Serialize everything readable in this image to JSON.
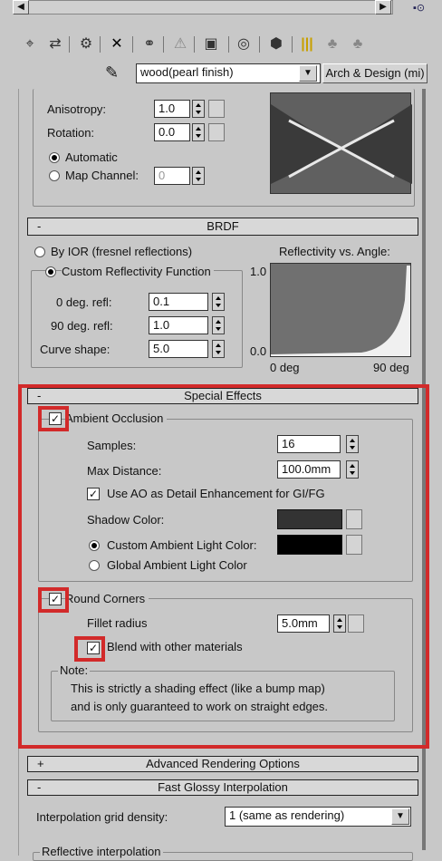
{
  "colors": {
    "panel": "#c8c8c8",
    "highlight": "#d22a2a",
    "shadow_swatch": "#333333",
    "ambient_swatch": "#000000"
  },
  "toolbar": {
    "icons": [
      "pick-material-icon",
      "put-to-scene-icon",
      "assign-material-icon",
      "delete-icon",
      "make-unique-icon",
      "put-to-library-icon",
      "material-id-icon",
      "show-map-icon",
      "show-end-result-icon",
      "go-to-parent-icon",
      "go-forward-icon"
    ]
  },
  "material": {
    "name": "wood(pearl finish)",
    "type": "Arch & Design (mi)"
  },
  "anisotropy": {
    "anisotropy_label": "Anisotropy:",
    "anisotropy_value": "1.0",
    "rotation_label": "Rotation:",
    "rotation_value": "0.0",
    "automatic_label": "Automatic",
    "map_channel_label": "Map Channel:",
    "map_channel_value": "0"
  },
  "brdf": {
    "title": "BRDF",
    "by_ior_label": "By IOR (fresnel reflections)",
    "custom_label": "Custom Reflectivity Function",
    "deg0_label": "0 deg. refl:",
    "deg0_value": "0.1",
    "deg90_label": "90 deg. refl:",
    "deg90_value": "1.0",
    "curve_label": "Curve shape:",
    "curve_value": "5.0",
    "graph_title": "Reflectivity vs. Angle:",
    "y_top": "1.0",
    "y_bottom": "0.0",
    "x_left": "0 deg",
    "x_right": "90 deg"
  },
  "special_effects": {
    "title": "Special Effects",
    "ao_label": "Ambient Occlusion",
    "samples_label": "Samples:",
    "samples_value": "16",
    "max_distance_label": "Max Distance:",
    "max_distance_value": "100.0mm",
    "use_ao_label": "Use AO as Detail Enhancement for GI/FG",
    "shadow_color_label": "Shadow Color:",
    "custom_ambient_label": "Custom Ambient Light Color:",
    "global_ambient_label": "Global Ambient Light Color",
    "round_corners_label": "Round Corners",
    "fillet_label": "Fillet radius",
    "fillet_value": "5.0mm",
    "blend_label": "Blend with other materials",
    "note_label": "Note:",
    "note_line1": "This is strictly a shading effect (like a bump map)",
    "note_line2": "and is only guaranteed to work on straight edges."
  },
  "rollouts": {
    "advanced_sign": "+",
    "advanced_title": "Advanced Rendering Options",
    "fast_sign": "-",
    "fast_title": "Fast Glossy Interpolation",
    "minus": "-"
  },
  "interp": {
    "grid_label": "Interpolation grid density:",
    "grid_value": "1 (same as rendering)",
    "reflective_label": "Reflective interpolation"
  }
}
